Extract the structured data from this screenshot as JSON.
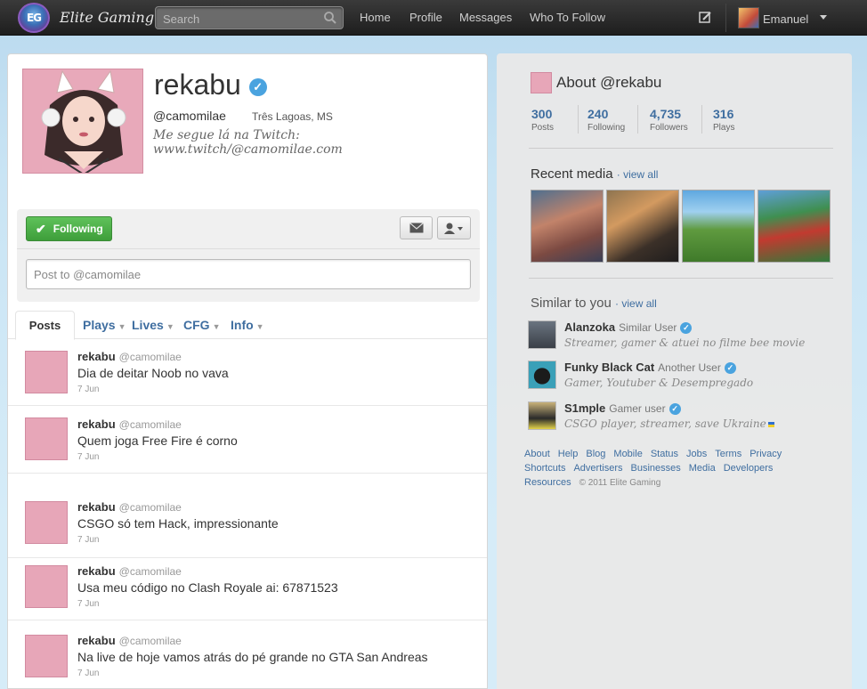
{
  "header": {
    "logo_text": "EG",
    "brand": "Elite Gaming",
    "search_placeholder": "Search",
    "nav": [
      "Home",
      "Profile",
      "Messages",
      "Who To Follow"
    ],
    "user_name": "Emanuel"
  },
  "profile": {
    "name": "rekabu",
    "handle": "@camomilae",
    "location": "Três Lagoas, MS",
    "bio": "Me segue lá na Twitch: www.twitch/@camomilae.com",
    "follow_label": "Following",
    "post_placeholder": "Post to @camomilae"
  },
  "tabs": {
    "active": "Posts",
    "others": [
      "Plays",
      "Lives",
      "CFG",
      "Info"
    ]
  },
  "tweets": [
    {
      "name": "rekabu",
      "handle": "@camomilae",
      "text": "Dia de deitar Noob no vava",
      "date": "7 Jun"
    },
    {
      "name": "rekabu",
      "handle": "@camomilae",
      "text": "Quem joga Free Fire é corno",
      "date": "7 Jun"
    },
    {
      "name": "rekabu",
      "handle": "@camomilae",
      "text": "CSGO só tem Hack, impressionante",
      "date": "7 Jun"
    },
    {
      "name": "rekabu",
      "handle": "@camomilae",
      "text": "Usa meu código no Clash Royale ai: 67871523",
      "date": "7 Jun"
    },
    {
      "name": "rekabu",
      "handle": "@camomilae",
      "text": "Na live de hoje vamos atrás do pé grande no GTA San Andreas",
      "date": "7 Jun"
    }
  ],
  "about": {
    "title": "About @rekabu",
    "stats": [
      {
        "num": "300",
        "label": "Posts"
      },
      {
        "num": "240",
        "label": "Following"
      },
      {
        "num": "4,735",
        "label": "Followers"
      },
      {
        "num": "316",
        "label": "Plays"
      }
    ],
    "recent_media_title": "Recent media",
    "view_all": "view all",
    "similar_title": "Similar to you",
    "similar": [
      {
        "name": "Alanzoka",
        "sub": "Similar User",
        "desc": "Streamer, gamer & atuei no filme bee movie"
      },
      {
        "name": "Funky Black Cat",
        "sub": "Another User",
        "desc": "Gamer, Youtuber & Desempregado"
      },
      {
        "name": "S1mple",
        "sub": "Gamer user",
        "desc": "CSGO player, streamer, save Ukraine"
      }
    ]
  },
  "footer": {
    "links": [
      "About",
      "Help",
      "Blog",
      "Mobile",
      "Status",
      "Jobs",
      "Terms",
      "Privacy",
      "Shortcuts",
      "Advertisers",
      "Businesses",
      "Media",
      "Developers",
      "Resources"
    ],
    "copyright": "© 2011 Elite Gaming"
  },
  "colors": {
    "accent": "#3f6ea0",
    "verified": "#4aa3df",
    "follow_green": "#4cb048"
  }
}
